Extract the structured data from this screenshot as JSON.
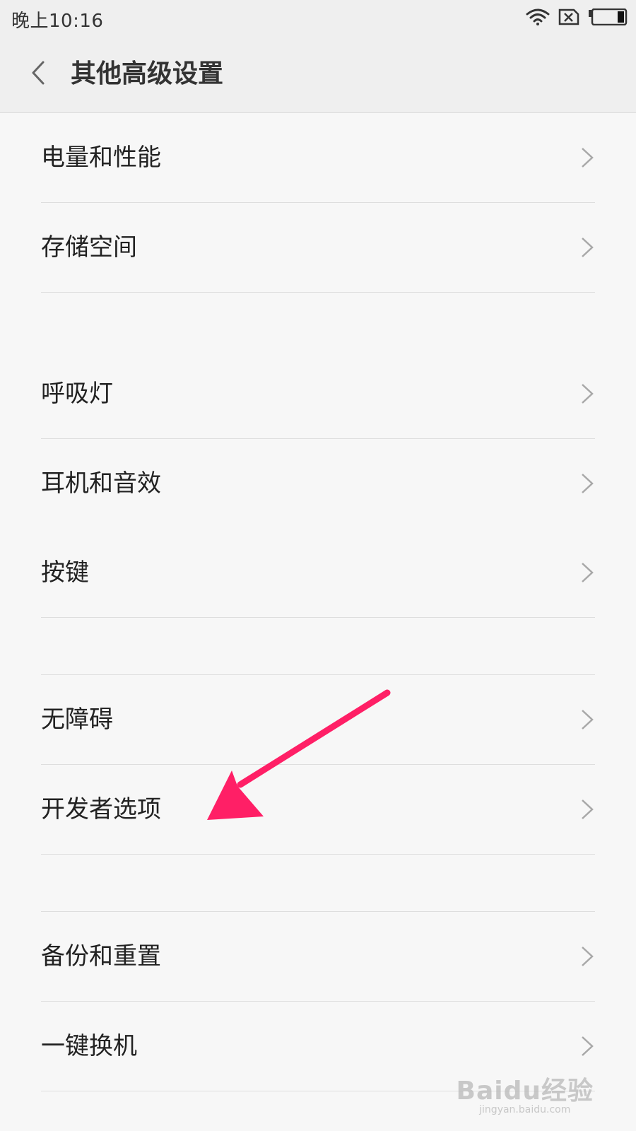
{
  "status_bar": {
    "time": "晚上10:16",
    "icons": [
      "wifi-icon",
      "sim-none-icon",
      "battery-icon"
    ]
  },
  "header": {
    "back_icon": "chevron-left-icon",
    "title": "其他高级设置"
  },
  "list": {
    "group1": [
      {
        "label": "电量和性能"
      },
      {
        "label": "存储空间"
      }
    ],
    "group2": [
      {
        "label": "呼吸灯"
      },
      {
        "label": "耳机和音效"
      },
      {
        "label": "按键"
      }
    ],
    "group3": [
      {
        "label": "无障碍"
      },
      {
        "label": "开发者选项"
      }
    ],
    "group4": [
      {
        "label": "备份和重置"
      },
      {
        "label": "一键换机"
      }
    ]
  },
  "annotation": {
    "arrow_color": "#ff1f66",
    "target": "开发者选项"
  },
  "watermark": {
    "logo": "baidu-jingyan-logo",
    "main": "Baidu经验",
    "sub": "jingyan.baidu.com"
  }
}
